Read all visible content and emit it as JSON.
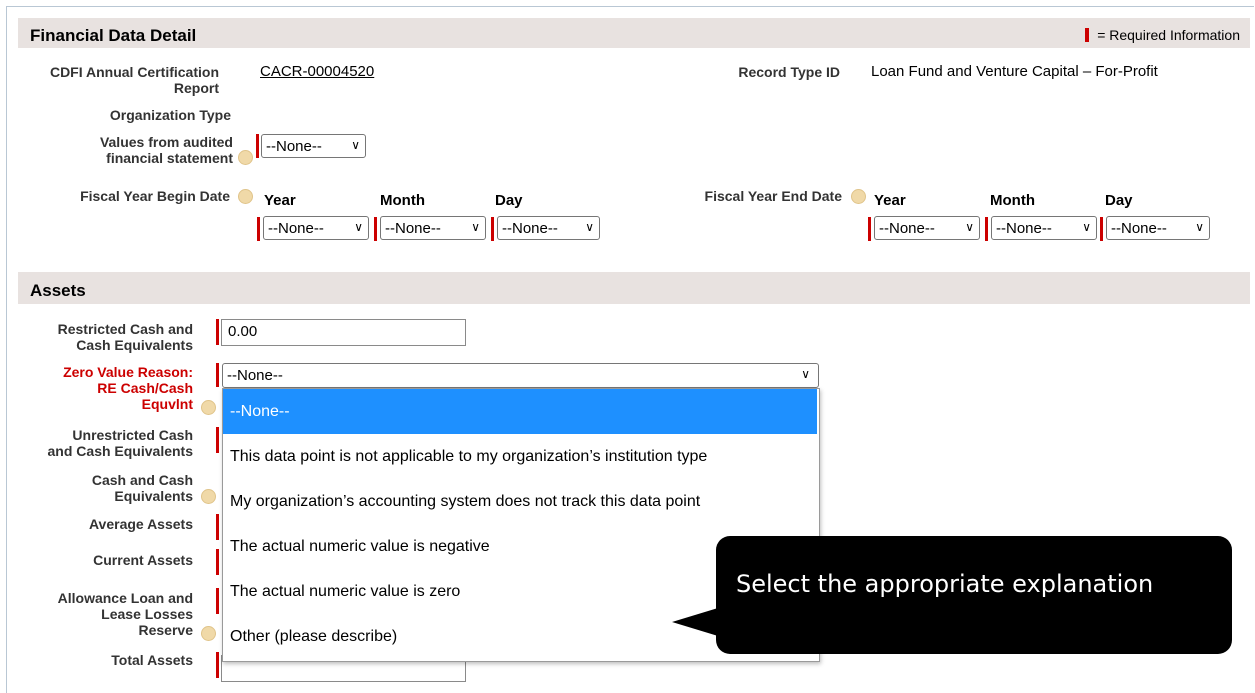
{
  "financial_section": {
    "title": "Financial Data Detail",
    "required_legend": "= Required Information",
    "cdfi_label": "CDFI Annual Certification Report",
    "cdfi_value": "CACR-00004520",
    "record_type_label": "Record Type ID",
    "record_type_value": "Loan Fund and Venture Capital – For-Profit",
    "org_type_label": "Organization Type",
    "audited_label_1": "Values from audited",
    "audited_label_2": "financial statement",
    "audited_value": "--None--",
    "fy_begin_label": "Fiscal Year Begin Date",
    "fy_end_label": "Fiscal Year End Date",
    "col_year": "Year",
    "col_month": "Month",
    "col_day": "Day",
    "none": "--None--"
  },
  "assets_section": {
    "title": "Assets",
    "restricted_label_1": "Restricted Cash and",
    "restricted_label_2": "Cash Equivalents",
    "restricted_value": "0.00",
    "zero_reason_label_1": "Zero Value Reason:",
    "zero_reason_label_2": "RE Cash/Cash",
    "zero_reason_label_3": "Equvlnt",
    "zero_reason_value": "--None--",
    "unrestricted_label_1": "Unrestricted Cash",
    "unrestricted_label_2": "and Cash Equivalents",
    "cash_label_1": "Cash and Cash",
    "cash_label_2": "Equivalents",
    "average_assets_label": "Average Assets",
    "current_assets_label": "Current Assets",
    "allowance_label_1": "Allowance Loan and",
    "allowance_label_2": "Lease Losses",
    "allowance_label_3": "Reserve",
    "total_assets_label": "Total Assets"
  },
  "dropdown": {
    "options": [
      "--None--",
      "This data point is not applicable to my organization’s institution type",
      "My organization’s accounting system does not track this data point",
      "The actual numeric value is negative",
      "The actual numeric value is zero",
      "Other (please describe)"
    ],
    "selected_index": 0
  },
  "callout": {
    "text": "Select the appropriate explanation"
  },
  "colors": {
    "required": "#cc0000",
    "header_bg": "#e8e2e0",
    "selected": "#1e90ff"
  }
}
